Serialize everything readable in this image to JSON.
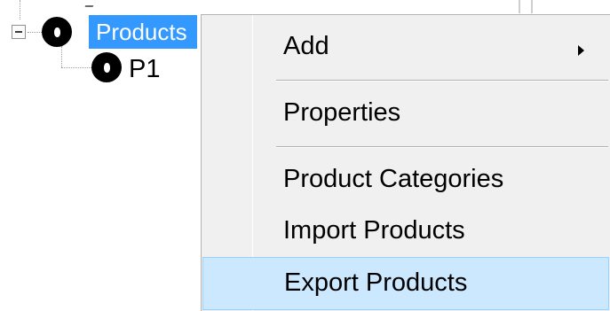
{
  "tree": {
    "root": {
      "label": "Products",
      "expanded": true,
      "selected": true,
      "icon": "product-node-icon"
    },
    "children": [
      {
        "label": "P1",
        "icon": "product-node-icon"
      }
    ]
  },
  "context_menu": {
    "items": [
      {
        "label": "Add",
        "has_submenu": true
      },
      {
        "label": "Properties"
      },
      {
        "label": "Product Categories"
      },
      {
        "label": "Import Products"
      },
      {
        "label": "Export Products",
        "highlighted": true
      }
    ]
  },
  "colors": {
    "selection": "#3399ff",
    "menu_background": "#f0f0f0",
    "menu_highlight": "#cce8ff",
    "menu_highlight_border": "#99d1ff"
  }
}
